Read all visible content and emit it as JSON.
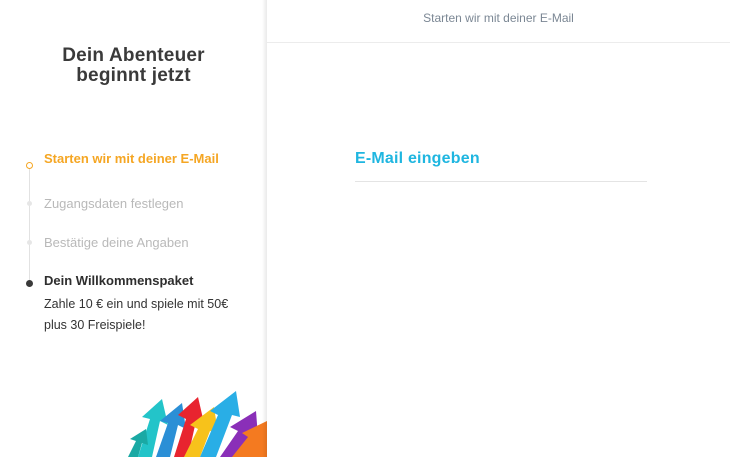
{
  "sidebar": {
    "title": "Dein Abenteuer beginnt jetzt",
    "steps": [
      {
        "label": "Starten wir mit deiner E-Mail",
        "state": "active"
      },
      {
        "label": "Zugangsdaten festlegen",
        "state": "pending"
      },
      {
        "label": "Bestätige deine Angaben",
        "state": "pending"
      },
      {
        "label": "Dein Willkommenspaket",
        "state": "info"
      }
    ],
    "welcome_description": "Zahle 10 € ein und spiele mit 50€ plus 30 Freispiele!"
  },
  "main": {
    "header": "Starten wir mit deiner E-Mail",
    "email_label": "E-Mail eingeben",
    "email_value": ""
  },
  "colors": {
    "active": "#f5a623",
    "accent": "#1fb6e0",
    "muted": "#b9b9b9",
    "text": "#3a3a3a"
  },
  "icons": [
    "step-active-icon",
    "step-pending-icon",
    "step-current-icon",
    "arrows-decoration-icon"
  ]
}
